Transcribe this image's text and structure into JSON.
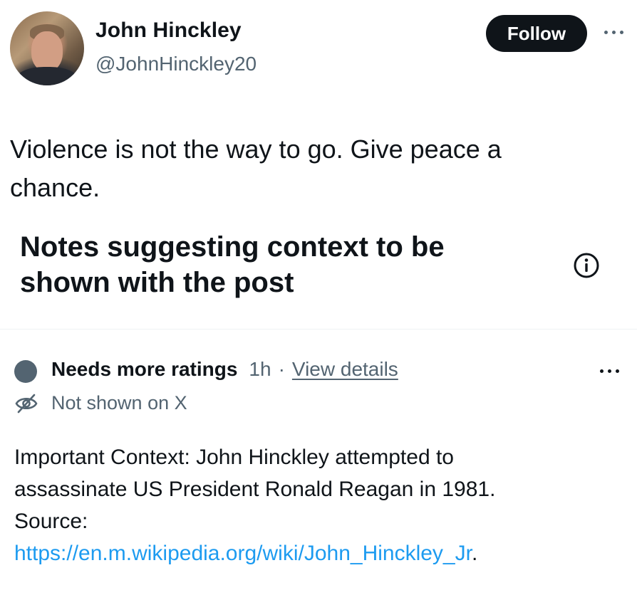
{
  "author": {
    "name": "John Hinckley",
    "handle": "@JohnHinckley20"
  },
  "actions": {
    "follow_label": "Follow"
  },
  "post": {
    "text": "Violence is not the way to go. Give peace a\nchance."
  },
  "notes_section": {
    "title": "Notes suggesting context to be shown with the post"
  },
  "note": {
    "status": "Needs more ratings",
    "time": "1h",
    "separator": "·",
    "view_details": "View details",
    "visibility": "Not shown on X",
    "text": "Important Context: John Hinckley attempted to\nassassinate US President Ronald Reagan in 1981.\nSource:",
    "link": "https://en.m.wikipedia.org/wiki/John_Hinckley_Jr",
    "link_suffix": "."
  },
  "colors": {
    "primary_text": "#0f1419",
    "secondary_text": "#536471",
    "link": "#1d9bf0",
    "follow_bg": "#0f1419",
    "status_dot": "#536471"
  },
  "icons": {
    "more": "more-horizontal-icon",
    "info": "info-circle-icon",
    "visibility": "eye-off-icon"
  }
}
